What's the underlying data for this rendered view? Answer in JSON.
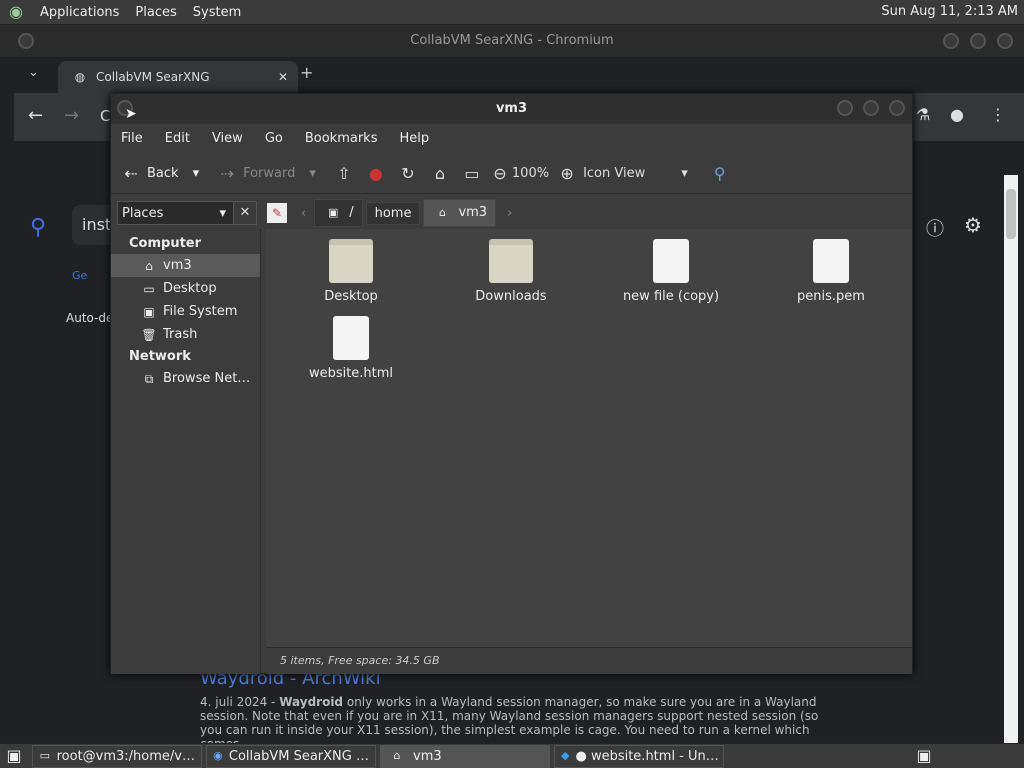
{
  "top_panel": {
    "menus": [
      "Applications",
      "Places",
      "System"
    ],
    "clock": "Sun Aug 11,  2:13 AM"
  },
  "chromium": {
    "window_title": "CollabVM SearXNG - Chromium",
    "tab_title": "CollabVM SearXNG",
    "search_prefix": "inst",
    "tab_label_partial": "Ge",
    "auto_detect_partial": "Auto-de"
  },
  "page_result": {
    "title": "Waydroid - ArchWiki",
    "date": "4. juli 2024 -",
    "bold": "Waydroid",
    "snippet": " only works in a Wayland session manager, so make sure you are in a Wayland session. Note that even if you are in X11, many Wayland session managers support nested session (so you can run it inside your X11 session), the simplest example is cage. You need to run a kernel which comes"
  },
  "file_manager": {
    "title": "vm3",
    "menus": [
      "File",
      "Edit",
      "View",
      "Go",
      "Bookmarks",
      "Help"
    ],
    "toolbar": {
      "back": "Back",
      "forward": "Forward",
      "zoom": "100%",
      "view_mode": "Icon View"
    },
    "side_pane_select": "Places",
    "path": [
      "/",
      "home",
      "vm3"
    ],
    "sidebar": {
      "computer_heading": "Computer",
      "network_heading": "Network",
      "items": [
        {
          "label": "vm3",
          "icon": "home-icon"
        },
        {
          "label": "Desktop",
          "icon": "desktop-icon"
        },
        {
          "label": "File System",
          "icon": "drive-icon"
        },
        {
          "label": "Trash",
          "icon": "trash-icon"
        }
      ],
      "network_items": [
        {
          "label": "Browse Net…",
          "icon": "network-icon"
        }
      ]
    },
    "files": [
      {
        "name": "Desktop",
        "type": "folder"
      },
      {
        "name": "Downloads",
        "type": "folder"
      },
      {
        "name": "new file (copy)",
        "type": "file"
      },
      {
        "name": "penis.pem",
        "type": "text"
      },
      {
        "name": "website.html",
        "type": "file"
      }
    ],
    "status": "5 items, Free space: 34.5 GB"
  },
  "taskbar": {
    "tasks": [
      "root@vm3:/home/v…",
      "CollabVM SearXNG …",
      "vm3",
      "● website.html - Un…"
    ]
  },
  "colors": {
    "accent_link": "#4a7bd8",
    "search_icon": "#3f6fe0"
  }
}
